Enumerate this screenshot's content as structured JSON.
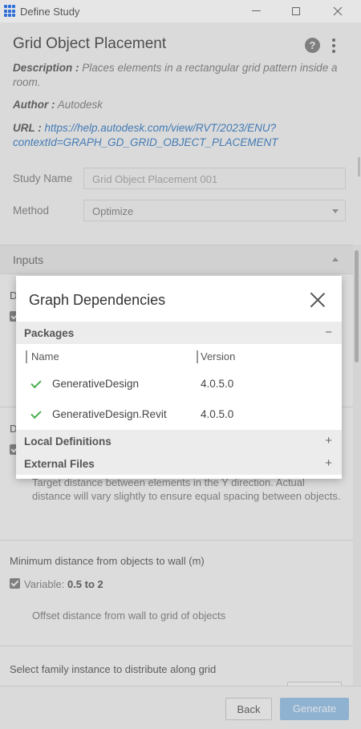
{
  "window": {
    "title": "Define Study",
    "controls": [
      "minimize-icon",
      "maximize-icon",
      "close-icon"
    ]
  },
  "header": {
    "title": "Grid Object Placement",
    "description_label": "Description :",
    "description": "Places elements in a rectangular grid pattern inside a room.",
    "author_label": "Author :",
    "author": "Autodesk",
    "url_label": "URL :",
    "url": "https://help.autodesk.com/view/RVT/2023/ENU?contextId=GRAPH_GD_GRID_OBJECT_PLACEMENT",
    "url_line1": "https://help.autodesk.com/view/RVT/2023/ENU?",
    "url_line2": "contextId=GRAPH_GD_GRID_OBJECT_PLACEMENT"
  },
  "study": {
    "name_label": "Study Name",
    "name_placeholder": "Grid Object Placement 001",
    "method_label": "Method",
    "method_value": "Optimize"
  },
  "inputs": {
    "title": "Inputs",
    "partial_letter_1": "D",
    "partial_letter_2": "D",
    "y_spacing_desc": "Target distance between elements in the Y direction. Actual distance will vary slightly to ensure equal spacing between objects.",
    "wall_label": "Minimum distance from objects to wall (m)",
    "wall_variable_label": "Variable:",
    "wall_variable_range": "0.5 to 2",
    "wall_desc": "Offset distance from wall to grid of objects",
    "family_label": "Select family instance to distribute along grid"
  },
  "footer": {
    "back_label": "Back",
    "generate_label": "Generate"
  },
  "modal": {
    "title": "Graph Dependencies",
    "packages_title": "Packages",
    "packages_sign": "−",
    "col_name": "Name",
    "col_version": "Version",
    "packages": [
      {
        "name": "GenerativeDesign",
        "version": "4.0.5.0"
      },
      {
        "name": "GenerativeDesign.Revit",
        "version": "4.0.5.0"
      }
    ],
    "local_title": "Local Definitions",
    "local_sign": "+",
    "external_title": "External Files",
    "external_sign": "+"
  },
  "colors": {
    "accent_link": "#4a86c5",
    "generate_button": "#9dc2e3",
    "check_green": "#4caf50",
    "app_icon": "#2f6fd6"
  }
}
